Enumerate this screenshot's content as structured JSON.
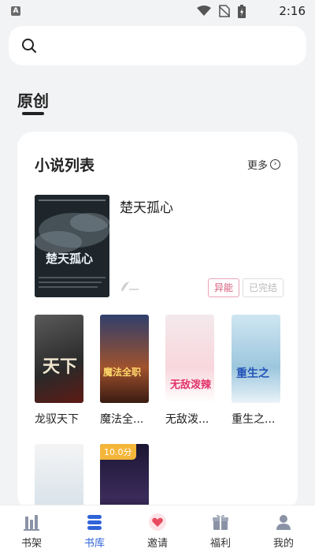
{
  "status_bar": {
    "time": "2:16",
    "app_badge": "A"
  },
  "search": {
    "placeholder": ""
  },
  "section": {
    "title": "原创"
  },
  "card": {
    "title": "小说列表",
    "more_label": "更多",
    "featured": {
      "title": "楚天孤心",
      "cover_title": "楚天孤心",
      "tags": [
        "异能",
        "已完结"
      ]
    },
    "books": [
      {
        "title": "龙驭天下",
        "cover_text": "天下"
      },
      {
        "title": "魔法全...",
        "cover_text": "魔法全职"
      },
      {
        "title": "无敌泼...",
        "cover_text": "无敌泼辣"
      },
      {
        "title": "重生之...",
        "cover_text": "重生之"
      },
      {
        "title": "",
        "cover_text": ""
      },
      {
        "title": "",
        "score": "10.0分",
        "cover_text": ""
      }
    ]
  },
  "tabs": [
    {
      "label": "书架",
      "icon": "bookshelf-icon",
      "active": false
    },
    {
      "label": "书库",
      "icon": "library-icon",
      "active": true
    },
    {
      "label": "邀请",
      "icon": "invite-heart-icon",
      "active": false
    },
    {
      "label": "福利",
      "icon": "gift-icon",
      "active": false
    },
    {
      "label": "我的",
      "icon": "profile-icon",
      "active": false
    }
  ],
  "colors": {
    "accent": "#2f64d8",
    "tag_pink": "#d55a7a",
    "score_badge": "#f4b63a",
    "invite_red": "#e84a5f"
  }
}
